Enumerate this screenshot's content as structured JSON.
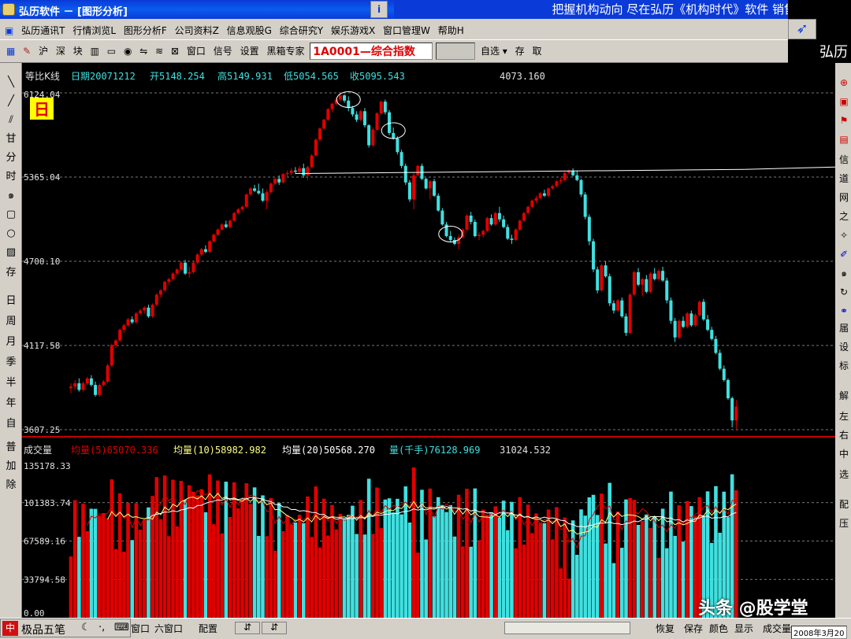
{
  "window": {
    "title": "弘历软件 － [图形分析]",
    "marquee": "把握机构动向 尽在弘历《机构时代》软件 销售"
  },
  "menu": [
    "弘历通讯T",
    "行情浏览L",
    "图形分析F",
    "公司资料Z",
    "信息观股G",
    "综合研究Y",
    "娱乐游戏X",
    "窗口管理W",
    "帮助H"
  ],
  "brand": "弘历",
  "toolbar": {
    "left": [
      "沪",
      "深",
      "块"
    ],
    "right": [
      "窗口",
      "信号",
      "设置",
      "黑箱专家"
    ],
    "code": "1A0001—综合指数",
    "select": "自选",
    "actions": [
      "存",
      "取"
    ]
  },
  "left_tools": [
    "甘",
    "分",
    "时",
    "存",
    "日",
    "周",
    "月",
    "季",
    "半",
    "年",
    "自",
    "普",
    "加",
    "除"
  ],
  "right_tools": [
    "信",
    "道",
    "网",
    "之",
    "届",
    "设",
    "标",
    "解",
    "左",
    "右",
    "中",
    "选",
    "配",
    "压"
  ],
  "info_line": {
    "label": "等比K线",
    "date": "日期20071212",
    "open": "开5148.254",
    "high": "高5149.931",
    "low": "低5054.565",
    "close": "收5095.543",
    "extra": "4073.160"
  },
  "period_badge": "日",
  "price_axis": [
    "6124.04",
    "5365.04",
    "4700.10",
    "4117.58",
    "3607.25"
  ],
  "volume_line": {
    "label": "成交量",
    "ma5": "均量(5)65070.336",
    "ma10": "均量(10)58982.982",
    "ma20": "均量(20)50568.270",
    "vol": "量(千手)76128.969",
    "extra": "31024.532"
  },
  "volume_axis": [
    "135178.33",
    "101383.74",
    "67589.16",
    "33794.58",
    "0.00"
  ],
  "status": {
    "ime": "极品五笔",
    "items": [
      "窗口",
      "六窗口",
      "配置"
    ],
    "right_items": [
      "恢复",
      "保存",
      "颜色",
      "显示",
      "成交量"
    ],
    "date": "2008年3月20"
  },
  "watermark": "头条 @股学堂",
  "colors": {
    "up": "#e00000",
    "down": "#40e0e0",
    "background": "#000000",
    "title_bar": "#0a3ad8"
  },
  "chart_data": {
    "type": "candlestick",
    "ylim": [
      3607.25,
      6124.04
    ],
    "price_ticks": [
      6124.04,
      5365.04,
      4700.1,
      4117.58,
      3607.25
    ],
    "candles": [
      {
        "o": 3850,
        "h": 3880,
        "l": 3820,
        "c": 3860
      },
      {
        "o": 3860,
        "h": 3900,
        "l": 3840,
        "c": 3880
      },
      {
        "o": 3880,
        "h": 3910,
        "l": 3830,
        "c": 3840
      },
      {
        "o": 3840,
        "h": 3890,
        "l": 3830,
        "c": 3880
      },
      {
        "o": 3880,
        "h": 3920,
        "l": 3870,
        "c": 3910
      },
      {
        "o": 3910,
        "h": 3930,
        "l": 3860,
        "c": 3870
      },
      {
        "o": 3870,
        "h": 3890,
        "l": 3800,
        "c": 3810
      },
      {
        "o": 3810,
        "h": 3880,
        "l": 3800,
        "c": 3870
      },
      {
        "o": 3870,
        "h": 3900,
        "l": 3860,
        "c": 3890
      },
      {
        "o": 3890,
        "h": 4000,
        "l": 3880,
        "c": 3990
      },
      {
        "o": 3990,
        "h": 4130,
        "l": 3980,
        "c": 4120
      },
      {
        "o": 4120,
        "h": 4160,
        "l": 4100,
        "c": 4150
      },
      {
        "o": 4150,
        "h": 4230,
        "l": 4140,
        "c": 4220
      },
      {
        "o": 4220,
        "h": 4260,
        "l": 4200,
        "c": 4250
      },
      {
        "o": 4250,
        "h": 4300,
        "l": 4240,
        "c": 4290
      },
      {
        "o": 4290,
        "h": 4310,
        "l": 4260,
        "c": 4270
      },
      {
        "o": 4270,
        "h": 4340,
        "l": 4260,
        "c": 4330
      },
      {
        "o": 4330,
        "h": 4360,
        "l": 4320,
        "c": 4350
      },
      {
        "o": 4350,
        "h": 4380,
        "l": 4330,
        "c": 4370
      },
      {
        "o": 4370,
        "h": 4390,
        "l": 4300,
        "c": 4310
      },
      {
        "o": 4310,
        "h": 4400,
        "l": 4300,
        "c": 4390
      },
      {
        "o": 4390,
        "h": 4470,
        "l": 4380,
        "c": 4460
      },
      {
        "o": 4460,
        "h": 4500,
        "l": 4440,
        "c": 4490
      },
      {
        "o": 4490,
        "h": 4560,
        "l": 4480,
        "c": 4550
      },
      {
        "o": 4550,
        "h": 4580,
        "l": 4530,
        "c": 4570
      },
      {
        "o": 4570,
        "h": 4620,
        "l": 4560,
        "c": 4610
      },
      {
        "o": 4610,
        "h": 4650,
        "l": 4600,
        "c": 4640
      },
      {
        "o": 4640,
        "h": 4700,
        "l": 4630,
        "c": 4690
      },
      {
        "o": 4690,
        "h": 4710,
        "l": 4600,
        "c": 4610
      },
      {
        "o": 4610,
        "h": 4660,
        "l": 4580,
        "c": 4620
      },
      {
        "o": 4620,
        "h": 4700,
        "l": 4610,
        "c": 4690
      },
      {
        "o": 4690,
        "h": 4760,
        "l": 4680,
        "c": 4750
      },
      {
        "o": 4750,
        "h": 4800,
        "l": 4740,
        "c": 4790
      },
      {
        "o": 4790,
        "h": 4820,
        "l": 4760,
        "c": 4770
      },
      {
        "o": 4770,
        "h": 4860,
        "l": 4760,
        "c": 4850
      },
      {
        "o": 4850,
        "h": 4910,
        "l": 4840,
        "c": 4900
      },
      {
        "o": 4900,
        "h": 4950,
        "l": 4890,
        "c": 4940
      },
      {
        "o": 4940,
        "h": 4990,
        "l": 4930,
        "c": 4980
      },
      {
        "o": 4980,
        "h": 5010,
        "l": 4950,
        "c": 4960
      },
      {
        "o": 4960,
        "h": 5020,
        "l": 4950,
        "c": 5010
      },
      {
        "o": 5010,
        "h": 5080,
        "l": 5000,
        "c": 5070
      },
      {
        "o": 5070,
        "h": 5110,
        "l": 5060,
        "c": 5100
      },
      {
        "o": 5100,
        "h": 5130,
        "l": 5090,
        "c": 5120
      },
      {
        "o": 5120,
        "h": 5230,
        "l": 5110,
        "c": 5220
      },
      {
        "o": 5220,
        "h": 5280,
        "l": 5210,
        "c": 5270
      },
      {
        "o": 5270,
        "h": 5300,
        "l": 5240,
        "c": 5250
      },
      {
        "o": 5250,
        "h": 5310,
        "l": 5220,
        "c": 5230
      },
      {
        "o": 5230,
        "h": 5270,
        "l": 5160,
        "c": 5170
      },
      {
        "o": 5170,
        "h": 5260,
        "l": 5100,
        "c": 5240
      },
      {
        "o": 5240,
        "h": 5320,
        "l": 5230,
        "c": 5310
      },
      {
        "o": 5310,
        "h": 5360,
        "l": 5300,
        "c": 5350
      },
      {
        "o": 5350,
        "h": 5380,
        "l": 5300,
        "c": 5320
      },
      {
        "o": 5320,
        "h": 5400,
        "l": 5310,
        "c": 5390
      },
      {
        "o": 5390,
        "h": 5420,
        "l": 5370,
        "c": 5400
      },
      {
        "o": 5400,
        "h": 5440,
        "l": 5380,
        "c": 5420
      },
      {
        "o": 5420,
        "h": 5450,
        "l": 5390,
        "c": 5410
      },
      {
        "o": 5410,
        "h": 5460,
        "l": 5400,
        "c": 5440
      },
      {
        "o": 5440,
        "h": 5480,
        "l": 5360,
        "c": 5380
      },
      {
        "o": 5380,
        "h": 5460,
        "l": 5340,
        "c": 5450
      },
      {
        "o": 5450,
        "h": 5560,
        "l": 5440,
        "c": 5550
      },
      {
        "o": 5550,
        "h": 5700,
        "l": 5540,
        "c": 5690
      },
      {
        "o": 5690,
        "h": 5800,
        "l": 5670,
        "c": 5790
      },
      {
        "o": 5790,
        "h": 5880,
        "l": 5780,
        "c": 5870
      },
      {
        "o": 5870,
        "h": 5980,
        "l": 5860,
        "c": 5970
      },
      {
        "o": 5970,
        "h": 6030,
        "l": 5940,
        "c": 6020
      },
      {
        "o": 6020,
        "h": 6080,
        "l": 6000,
        "c": 6060
      },
      {
        "o": 6060,
        "h": 6124,
        "l": 6040,
        "c": 6100
      },
      {
        "o": 6100,
        "h": 6110,
        "l": 6030,
        "c": 6050
      },
      {
        "o": 6050,
        "h": 6090,
        "l": 5950,
        "c": 5980
      },
      {
        "o": 5980,
        "h": 6000,
        "l": 5900,
        "c": 5920
      },
      {
        "o": 5920,
        "h": 5950,
        "l": 5850,
        "c": 5870
      },
      {
        "o": 5870,
        "h": 5960,
        "l": 5860,
        "c": 5950
      },
      {
        "o": 5950,
        "h": 5980,
        "l": 5800,
        "c": 5820
      },
      {
        "o": 5820,
        "h": 5830,
        "l": 5620,
        "c": 5640
      },
      {
        "o": 5640,
        "h": 5800,
        "l": 5630,
        "c": 5780
      },
      {
        "o": 5780,
        "h": 5940,
        "l": 5770,
        "c": 5930
      },
      {
        "o": 5930,
        "h": 6050,
        "l": 5920,
        "c": 6040
      },
      {
        "o": 6040,
        "h": 6060,
        "l": 5920,
        "c": 5940
      },
      {
        "o": 5940,
        "h": 5960,
        "l": 5730,
        "c": 5750
      },
      {
        "o": 5750,
        "h": 5800,
        "l": 5690,
        "c": 5700
      },
      {
        "o": 5700,
        "h": 5720,
        "l": 5560,
        "c": 5580
      },
      {
        "o": 5580,
        "h": 5600,
        "l": 5440,
        "c": 5460
      },
      {
        "o": 5460,
        "h": 5480,
        "l": 5300,
        "c": 5320
      },
      {
        "o": 5320,
        "h": 5340,
        "l": 5160,
        "c": 5180
      },
      {
        "o": 5180,
        "h": 5400,
        "l": 5100,
        "c": 5380
      },
      {
        "o": 5380,
        "h": 5470,
        "l": 5370,
        "c": 5460
      },
      {
        "o": 5460,
        "h": 5480,
        "l": 5340,
        "c": 5350
      },
      {
        "o": 5350,
        "h": 5360,
        "l": 5260,
        "c": 5270
      },
      {
        "o": 5270,
        "h": 5340,
        "l": 5180,
        "c": 5330
      },
      {
        "o": 5330,
        "h": 5350,
        "l": 5200,
        "c": 5210
      },
      {
        "o": 5210,
        "h": 5230,
        "l": 5080,
        "c": 5090
      },
      {
        "o": 5090,
        "h": 5110,
        "l": 4970,
        "c": 4980
      },
      {
        "o": 4980,
        "h": 5000,
        "l": 4880,
        "c": 4890
      },
      {
        "o": 4890,
        "h": 4930,
        "l": 4840,
        "c": 4860
      },
      {
        "o": 4860,
        "h": 4880,
        "l": 4820,
        "c": 4830
      },
      {
        "o": 4830,
        "h": 4900,
        "l": 4790,
        "c": 4880
      },
      {
        "o": 4880,
        "h": 4950,
        "l": 4870,
        "c": 4940
      },
      {
        "o": 4940,
        "h": 5060,
        "l": 4930,
        "c": 5050
      },
      {
        "o": 5050,
        "h": 5080,
        "l": 4980,
        "c": 5000
      },
      {
        "o": 5000,
        "h": 5020,
        "l": 4880,
        "c": 4890
      },
      {
        "o": 4890,
        "h": 4920,
        "l": 4860,
        "c": 4900
      },
      {
        "o": 4900,
        "h": 4940,
        "l": 4880,
        "c": 4930
      },
      {
        "o": 4930,
        "h": 5040,
        "l": 4920,
        "c": 5030
      },
      {
        "o": 5030,
        "h": 5060,
        "l": 4970,
        "c": 4980
      },
      {
        "o": 4980,
        "h": 5080,
        "l": 4970,
        "c": 5070
      },
      {
        "o": 5070,
        "h": 5120,
        "l": 5000,
        "c": 5020
      },
      {
        "o": 5020,
        "h": 5050,
        "l": 4950,
        "c": 4960
      },
      {
        "o": 4960,
        "h": 4980,
        "l": 4860,
        "c": 4870
      },
      {
        "o": 4870,
        "h": 4900,
        "l": 4830,
        "c": 4860
      },
      {
        "o": 4860,
        "h": 4950,
        "l": 4850,
        "c": 4940
      },
      {
        "o": 4940,
        "h": 5020,
        "l": 4930,
        "c": 5010
      },
      {
        "o": 5010,
        "h": 5080,
        "l": 5000,
        "c": 5070
      },
      {
        "o": 5070,
        "h": 5130,
        "l": 5060,
        "c": 5120
      },
      {
        "o": 5120,
        "h": 5180,
        "l": 5110,
        "c": 5170
      },
      {
        "o": 5170,
        "h": 5210,
        "l": 5150,
        "c": 5190
      },
      {
        "o": 5190,
        "h": 5240,
        "l": 5180,
        "c": 5230
      },
      {
        "o": 5230,
        "h": 5260,
        "l": 5200,
        "c": 5210
      },
      {
        "o": 5210,
        "h": 5280,
        "l": 5200,
        "c": 5270
      },
      {
        "o": 5270,
        "h": 5300,
        "l": 5260,
        "c": 5290
      },
      {
        "o": 5290,
        "h": 5340,
        "l": 5280,
        "c": 5330
      },
      {
        "o": 5330,
        "h": 5360,
        "l": 5310,
        "c": 5340
      },
      {
        "o": 5340,
        "h": 5410,
        "l": 5330,
        "c": 5400
      },
      {
        "o": 5400,
        "h": 5430,
        "l": 5390,
        "c": 5420
      },
      {
        "o": 5420,
        "h": 5440,
        "l": 5370,
        "c": 5380
      },
      {
        "o": 5380,
        "h": 5420,
        "l": 5330,
        "c": 5340
      },
      {
        "o": 5340,
        "h": 5350,
        "l": 5200,
        "c": 5220
      },
      {
        "o": 5220,
        "h": 5240,
        "l": 5020,
        "c": 5040
      },
      {
        "o": 5040,
        "h": 5060,
        "l": 4820,
        "c": 4850
      },
      {
        "o": 4850,
        "h": 4870,
        "l": 4620,
        "c": 4640
      },
      {
        "o": 4640,
        "h": 4660,
        "l": 4470,
        "c": 4490
      },
      {
        "o": 4490,
        "h": 4680,
        "l": 4480,
        "c": 4670
      },
      {
        "o": 4670,
        "h": 4700,
        "l": 4580,
        "c": 4590
      },
      {
        "o": 4590,
        "h": 4610,
        "l": 4380,
        "c": 4400
      },
      {
        "o": 4400,
        "h": 4420,
        "l": 4330,
        "c": 4350
      },
      {
        "o": 4350,
        "h": 4430,
        "l": 4340,
        "c": 4420
      },
      {
        "o": 4420,
        "h": 4440,
        "l": 4300,
        "c": 4310
      },
      {
        "o": 4310,
        "h": 4330,
        "l": 4180,
        "c": 4200
      },
      {
        "o": 4200,
        "h": 4470,
        "l": 4190,
        "c": 4460
      },
      {
        "o": 4460,
        "h": 4630,
        "l": 4450,
        "c": 4620
      },
      {
        "o": 4620,
        "h": 4650,
        "l": 4520,
        "c": 4530
      },
      {
        "o": 4530,
        "h": 4580,
        "l": 4450,
        "c": 4570
      },
      {
        "o": 4570,
        "h": 4600,
        "l": 4470,
        "c": 4480
      },
      {
        "o": 4480,
        "h": 4620,
        "l": 4470,
        "c": 4610
      },
      {
        "o": 4610,
        "h": 4650,
        "l": 4560,
        "c": 4570
      },
      {
        "o": 4570,
        "h": 4640,
        "l": 4560,
        "c": 4630
      },
      {
        "o": 4630,
        "h": 4660,
        "l": 4550,
        "c": 4560
      },
      {
        "o": 4560,
        "h": 4580,
        "l": 4400,
        "c": 4420
      },
      {
        "o": 4420,
        "h": 4440,
        "l": 4260,
        "c": 4280
      },
      {
        "o": 4280,
        "h": 4300,
        "l": 4140,
        "c": 4170
      },
      {
        "o": 4170,
        "h": 4290,
        "l": 4160,
        "c": 4280
      },
      {
        "o": 4280,
        "h": 4310,
        "l": 4230,
        "c": 4240
      },
      {
        "o": 4240,
        "h": 4340,
        "l": 4230,
        "c": 4330
      },
      {
        "o": 4330,
        "h": 4350,
        "l": 4240,
        "c": 4250
      },
      {
        "o": 4250,
        "h": 4330,
        "l": 4240,
        "c": 4320
      },
      {
        "o": 4320,
        "h": 4420,
        "l": 4310,
        "c": 4410
      },
      {
        "o": 4410,
        "h": 4430,
        "l": 4280,
        "c": 4290
      },
      {
        "o": 4290,
        "h": 4320,
        "l": 4210,
        "c": 4220
      },
      {
        "o": 4220,
        "h": 4240,
        "l": 4150,
        "c": 4160
      },
      {
        "o": 4160,
        "h": 4180,
        "l": 4060,
        "c": 4070
      },
      {
        "o": 4070,
        "h": 4090,
        "l": 3960,
        "c": 3970
      },
      {
        "o": 3970,
        "h": 3990,
        "l": 3890,
        "c": 3900
      },
      {
        "o": 3900,
        "h": 3910,
        "l": 3780,
        "c": 3790
      },
      {
        "o": 3790,
        "h": 3800,
        "l": 3620,
        "c": 3660
      },
      {
        "o": 3660,
        "h": 3780,
        "l": 3607,
        "c": 3740
      }
    ],
    "neckline": {
      "start_index": 55,
      "end_index": 165,
      "y0": 5395,
      "y1": 5430
    },
    "circled_indices": [
      68,
      79,
      93
    ],
    "volume": {
      "ylim": [
        0,
        135178.33
      ],
      "ticks": [
        135178.33,
        101383.74,
        67589.16,
        33794.58,
        0.0
      ],
      "ma_series": [
        {
          "name": "均量(5)",
          "color": "#e00000"
        },
        {
          "name": "均量(10)",
          "color": "#ffff80"
        },
        {
          "name": "均量(20)",
          "color": "#ffffff"
        }
      ]
    }
  }
}
